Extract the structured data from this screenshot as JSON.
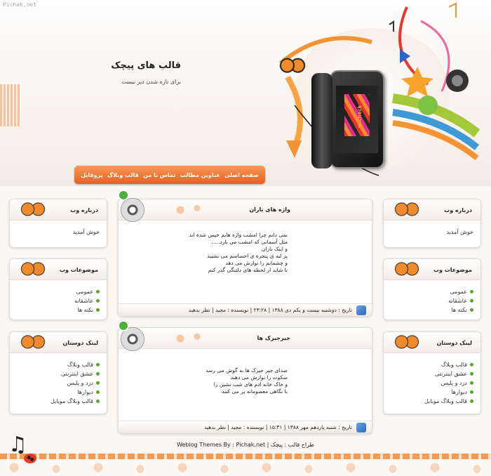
{
  "watermark": "Pichak.net",
  "header": {
    "title": "قالب های پیچک",
    "description": "برای تازه شدن دیر نیست",
    "phone_text": "micheck"
  },
  "nav": {
    "items": [
      "صفحه اصلی",
      "عناوین مطالب",
      "تماس با من",
      "قالب وبلاگ",
      "پروفایل"
    ]
  },
  "right_sidebar": {
    "about": {
      "title": "درباره وب",
      "text": "خوش آمدید"
    },
    "topics": {
      "title": "موضوعات وب",
      "items": [
        "عمومی",
        "عاشقانه",
        "نکته ها"
      ]
    },
    "links": {
      "title": "لینک دوستان",
      "items": [
        "قالب وبلاگ",
        "عشق اینترنتی",
        "دزد و پلیس",
        "دیوارها",
        "قالب وبلاگ موبایل"
      ]
    }
  },
  "left_sidebar": {
    "about": {
      "title": "درباره وب",
      "text": "خوش آمدید"
    },
    "topics": {
      "title": "موضوعات وب",
      "items": [
        "عمومی",
        "عاشقانه",
        "نکته ها"
      ]
    },
    "links": {
      "title": "لینک دوستان",
      "items": [
        "قالب وبلاگ",
        "عشق اینترنتی",
        "دزد و پلیس",
        "دیوارها",
        "قالب وبلاگ موبایل"
      ]
    }
  },
  "posts": [
    {
      "title": "واژه های باران",
      "lines": [
        "نمی دانم چرا امشب واژه هایم خیس شده اند",
        "مثل آسمانی که امشب می بارد.....",
        "و اینک باران",
        "پز لبه ی پنجره ی احساسم می نشیند",
        "و چشمانم را نوازش می دهد",
        "تا شاید از لحظه های دلتنگی گذر کنم"
      ],
      "footer": "تاریخ : دوشنبه بیست و یکم دی ۱۳۸۸ | ۲۳:۲۸ | نویسنده : مجید | نظر بدهید"
    },
    {
      "title": "جیرجیرک ها",
      "lines": [
        "صدای جیر جیرک ها به گوش می رسد",
        "سکوت را نوازش می دهند",
        "و خاک خانه ادم های شب نشین را",
        "با نگاهی معصومانه پر می کنند"
      ],
      "footer": "تاریخ : شنبه یازدهم مهر ۱۳۸۸ | ۱۵:۴۱ | نویسنده : مجید | نظر بدهید"
    }
  ],
  "footer": {
    "design_label": "طراح قالب : پیچک",
    "separator": "|",
    "themes_label": "Weblog Themes By : Pichak.net"
  },
  "colors": {
    "accent": "#f07a2e",
    "nav_dark": "#e8601c",
    "bullet": "#5aa52a"
  }
}
